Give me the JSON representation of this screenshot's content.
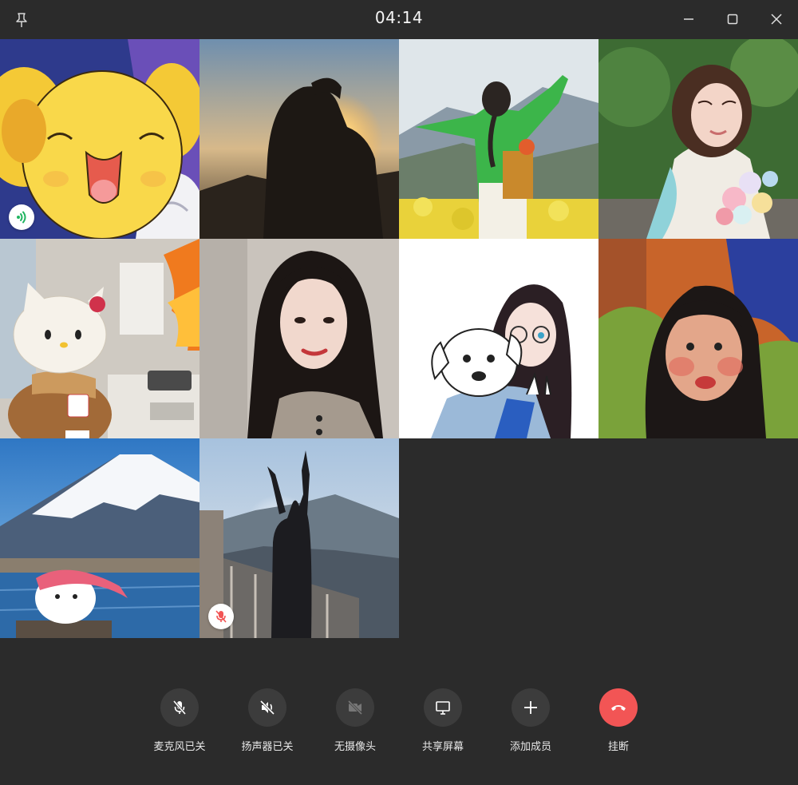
{
  "window": {
    "timer": "04:14"
  },
  "participants": [
    {
      "avatar": "cartoon-bear-avatar",
      "status": "speaking"
    },
    {
      "avatar": "sunset-silhouette-avatar",
      "status": ""
    },
    {
      "avatar": "girl-green-jacket-flowers-avatar",
      "status": ""
    },
    {
      "avatar": "girl-with-bouquet-avatar",
      "status": ""
    },
    {
      "avatar": "hello-kitty-office-avatar",
      "status": ""
    },
    {
      "avatar": "girl-portrait-avatar",
      "status": ""
    },
    {
      "avatar": "drawing-girl-with-dog-avatar",
      "status": ""
    },
    {
      "avatar": "girl-green-sweater-selfie-avatar",
      "status": ""
    },
    {
      "avatar": "mount-fuji-plush-avatar",
      "status": ""
    },
    {
      "avatar": "mountain-silhouette-avatar",
      "status": "muted"
    }
  ],
  "controls": {
    "mic": "麦克风已关",
    "speaker": "扬声器已关",
    "camera": "无摄像头",
    "share": "共享屏幕",
    "add": "添加成员",
    "hangup": "挂断"
  },
  "colors": {
    "background": "#2b2b2b",
    "button": "#3c3c3c",
    "hangup": "#f25555",
    "speaking": "#21b561",
    "muted": "#f25555"
  }
}
